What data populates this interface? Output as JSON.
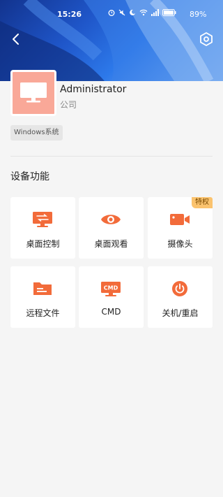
{
  "status_bar": {
    "time": "15:26",
    "battery": "89%",
    "icons": [
      "alarm-icon",
      "mute-icon",
      "dnd-icon",
      "wifi-icon",
      "signal-icon",
      "battery-icon"
    ]
  },
  "header": {
    "back_icon": "back-icon",
    "settings_icon": "settings-icon"
  },
  "device": {
    "name": "Administrator",
    "group": "公司",
    "os_tag": "Windows系统",
    "avatar_icon": "monitor-icon"
  },
  "features": {
    "title": "设备功能",
    "items": [
      {
        "label": "桌面控制",
        "icon": "desktop-control-icon",
        "badge": ""
      },
      {
        "label": "桌面观看",
        "icon": "eye-icon",
        "badge": ""
      },
      {
        "label": "摄像头",
        "icon": "camera-icon",
        "badge": "特权"
      },
      {
        "label": "远程文件",
        "icon": "folder-icon",
        "badge": ""
      },
      {
        "label": "CMD",
        "icon": "cmd-icon",
        "badge": ""
      },
      {
        "label": "关机/重启",
        "icon": "power-icon",
        "badge": ""
      }
    ],
    "cmd_icon_text": "CMD"
  },
  "colors": {
    "accent": "#f26b3a",
    "avatar_bg": "#f9a898",
    "badge_bg": "#fbc36e"
  }
}
